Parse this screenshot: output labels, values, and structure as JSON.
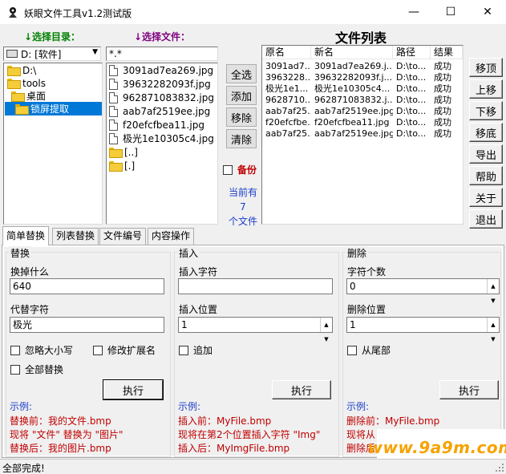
{
  "window": {
    "title": "妖眼文件工具v1.2测试版",
    "minimize": "—",
    "maximize": "☐",
    "close": "✕"
  },
  "labels": {
    "select_dir": "↓选择目录：",
    "select_file": "↓选择文件：",
    "file_list": "文件列表"
  },
  "drive": {
    "value": "D: [软件]"
  },
  "tree": [
    {
      "label": "D:\\"
    },
    {
      "label": "tools"
    },
    {
      "label": "桌面"
    },
    {
      "label": "锁屏提取"
    }
  ],
  "filter": {
    "value": "*.*"
  },
  "files": [
    {
      "name": "3091ad7ea269.jpg",
      "kind": "file"
    },
    {
      "name": "39632282093f.jpg",
      "kind": "file"
    },
    {
      "name": "962871083832.jpg",
      "kind": "file"
    },
    {
      "name": "aab7af2519ee.jpg",
      "kind": "file"
    },
    {
      "name": "f20efcfbea11.jpg",
      "kind": "file"
    },
    {
      "name": "极光1e10305c4.jpg",
      "kind": "file"
    },
    {
      "name": "[..]",
      "kind": "folder"
    },
    {
      "name": "[.]",
      "kind": "folder"
    }
  ],
  "mid_buttons": {
    "select_all": "全选",
    "add": "添加",
    "remove": "移除",
    "clear": "清除"
  },
  "backup": {
    "label": "备份"
  },
  "count_text": {
    "line1": "当前有",
    "line2": "7",
    "line3": "个文件"
  },
  "list": {
    "headers": [
      "原名",
      "新名",
      "路径",
      "结果"
    ],
    "rows": [
      [
        "3091ad7...",
        "3091ad7ea269.j...",
        "D:\\to...",
        "成功"
      ],
      [
        "3963228...",
        "39632282093f.j...",
        "D:\\to...",
        "成功"
      ],
      [
        "极光1e1...",
        "极光1e10305c4...",
        "D:\\to...",
        "成功"
      ],
      [
        "9628710...",
        "962871083832.j...",
        "D:\\to...",
        "成功"
      ],
      [
        "aab7af25...",
        "aab7af2519ee.jpg",
        "D:\\to...",
        "成功"
      ],
      [
        "f20efcfbe...",
        "f20efcfbea11.jpg",
        "D:\\to...",
        "成功"
      ],
      [
        "aab7af25...",
        "aab7af2519ee.jpg",
        "D:\\to...",
        "成功"
      ]
    ]
  },
  "right_buttons": {
    "top": "移顶",
    "up": "上移",
    "down": "下移",
    "bottom": "移底",
    "export": "导出",
    "help": "帮助",
    "about": "关于",
    "exit": "退出"
  },
  "tabs": [
    "简单替换",
    "列表替换",
    "文件编号",
    "内容操作"
  ],
  "replace": {
    "group": "替换",
    "find_label": "换掉什么",
    "find_value": "640",
    "with_label": "代替字符",
    "with_value": "极光",
    "ignore_case": "忽略大小写",
    "change_ext": "修改扩展名",
    "replace_all": "全部替换",
    "run": "执行",
    "ex_title": "示例:",
    "ex_1": "替换前：我的文件.bmp",
    "ex_2": "现将 \"文件\" 替换为 \"图片\"",
    "ex_3": "替换后：我的图片.bmp"
  },
  "insert": {
    "group": "插入",
    "char_label": "插入字符",
    "char_value": "",
    "pos_label": "插入位置",
    "pos_value": "1",
    "append": "追加",
    "run": "执行",
    "ex_title": "示例:",
    "ex_1": "插入前：MyFile.bmp",
    "ex_2": "现将在第2个位置插入字符 \"Img\"",
    "ex_3": "插入后：MyImgFile.bmp"
  },
  "delete": {
    "group": "删除",
    "count_label": "字符个数",
    "count_value": "0",
    "pos_label": "删除位置",
    "pos_value": "1",
    "from_end": "从尾部",
    "run": "执行",
    "ex_title": "示例:",
    "ex_1": "删除前：MyFile.bmp",
    "ex_2": "现将从",
    "ex_3": "删除后"
  },
  "status": {
    "text": "全部完成!"
  },
  "watermark": {
    "text": "www.9a9m.com"
  },
  "colors": {
    "green": "#008000",
    "purple": "#800080",
    "red": "#c00000",
    "blue": "#1a3ec8",
    "selection": "#0078d7",
    "watermark": "#f5a300"
  }
}
